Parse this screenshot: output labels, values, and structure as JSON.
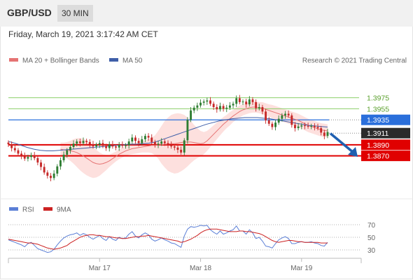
{
  "header": {
    "pair": "GBP/USD",
    "timeframe": "30 MIN"
  },
  "datetime": "Friday, March 19, 2021 3:17:42 AM CET",
  "legend": {
    "ma20": "MA 20 + Bollinger Bands",
    "ma50": "MA 50",
    "copyright": "Research © 2021 Trading Central"
  },
  "rsi_legend": {
    "rsi": "RSI",
    "ma9": "9MA"
  },
  "colors": {
    "up": "#2e7d32",
    "down": "#c62828",
    "ma20": "#e57373",
    "ma50": "#3f5fa8",
    "band": "#fde0de",
    "resistance": "#8ccf6a",
    "support": "#e00000",
    "pivot": "#2a6fdb",
    "arrow": "#1f5fb0",
    "rsi": "#5b7fd6",
    "rsi_ma": "#cc2222"
  },
  "chart_data": {
    "type": "candlestick",
    "ylim": [
      1.3795,
      1.4025
    ],
    "levels": [
      {
        "value": 1.3975,
        "label": "1.3975",
        "kind": "resistance"
      },
      {
        "value": 1.3955,
        "label": "1.3955",
        "kind": "resistance"
      },
      {
        "value": 1.3935,
        "label": "1.3935",
        "kind": "pivot"
      },
      {
        "value": 1.3911,
        "label": "1.3911",
        "kind": "last"
      },
      {
        "value": 1.389,
        "label": "1.3890",
        "kind": "support"
      },
      {
        "value": 1.387,
        "label": "1.3870",
        "kind": "support"
      }
    ],
    "x_tick_labels": [
      "Mar 17",
      "Mar 18",
      "Mar 19"
    ],
    "x_ticks_at": [
      28,
      59,
      90
    ],
    "closes": [
      1.3891,
      1.3884,
      1.388,
      1.3874,
      1.387,
      1.3865,
      1.3868,
      1.3871,
      1.3866,
      1.3858,
      1.385,
      1.384,
      1.3834,
      1.383,
      1.3838,
      1.3851,
      1.3862,
      1.3872,
      1.388,
      1.3886,
      1.3892,
      1.3896,
      1.3893,
      1.3897,
      1.3895,
      1.3891,
      1.3887,
      1.389,
      1.3893,
      1.3888,
      1.3884,
      1.3891,
      1.3887,
      1.3885,
      1.389,
      1.3888,
      1.3889,
      1.3896,
      1.3903,
      1.3897,
      1.3893,
      1.39,
      1.3906,
      1.3903,
      1.3895,
      1.389,
      1.3892,
      1.3896,
      1.3893,
      1.389,
      1.3887,
      1.3885,
      1.3881,
      1.3876,
      1.3898,
      1.3935,
      1.3952,
      1.3957,
      1.3961,
      1.3966,
      1.3968,
      1.397,
      1.3964,
      1.3958,
      1.3954,
      1.396,
      1.3955,
      1.3957,
      1.3961,
      1.3964,
      1.3974,
      1.3967,
      1.3968,
      1.3963,
      1.3972,
      1.3967,
      1.3956,
      1.3958,
      1.395,
      1.3934,
      1.3928,
      1.3922,
      1.393,
      1.3937,
      1.3943,
      1.3946,
      1.3943,
      1.3926,
      1.392,
      1.3923,
      1.3925,
      1.3924,
      1.3923,
      1.3924,
      1.3922,
      1.392,
      1.3912,
      1.3906,
      1.3913
    ],
    "ma20": [
      1.3882,
      1.3881,
      1.388,
      1.3879,
      1.3878,
      1.3876,
      1.3873,
      1.387,
      1.3866,
      1.3862,
      1.3858,
      1.3856,
      1.3855,
      1.3856,
      1.3858,
      1.3861,
      1.3865,
      1.3869,
      1.3873,
      1.3876,
      1.3879,
      1.3881,
      1.3883,
      1.3884,
      1.3885,
      1.3886,
      1.3887,
      1.3888,
      1.3889,
      1.3889,
      1.389,
      1.389,
      1.3891,
      1.3891,
      1.3892,
      1.3892,
      1.3893,
      1.3894,
      1.3895,
      1.3895,
      1.3895,
      1.3894,
      1.3893,
      1.3892,
      1.3893,
      1.3897,
      1.3903,
      1.3909,
      1.3915,
      1.3921,
      1.3927,
      1.3932,
      1.3937,
      1.3942,
      1.3946,
      1.395,
      1.3953,
      1.3955,
      1.3957,
      1.3958,
      1.3958,
      1.3957,
      1.3956,
      1.3954,
      1.3952,
      1.395,
      1.3948,
      1.3946,
      1.3944,
      1.3942,
      1.394,
      1.3938,
      1.3936,
      1.3934,
      1.3931,
      1.3928,
      1.3925,
      1.3923,
      1.3921,
      1.3919,
      1.3917,
      1.3916,
      1.3915
    ],
    "ma20_start": 16,
    "bb_halfwidth": [
      0.0012,
      0.0013,
      0.0015,
      0.0018,
      0.0022,
      0.0026,
      0.0029,
      0.0031,
      0.0031,
      0.003,
      0.0028,
      0.0025,
      0.0021,
      0.0017,
      0.0014,
      0.0011,
      0.001,
      0.0009,
      0.0009,
      0.0009,
      0.0009,
      0.0009,
      0.001,
      0.001,
      0.001,
      0.001,
      0.0011,
      0.0012,
      0.0014,
      0.0018,
      0.0025,
      0.0034,
      0.0042,
      0.0048,
      0.0052,
      0.0054,
      0.0054,
      0.0052,
      0.0049,
      0.0044,
      0.0038,
      0.0032,
      0.0027,
      0.0023,
      0.002,
      0.0018,
      0.0017,
      0.0016,
      0.0015,
      0.0014,
      0.0013,
      0.0012,
      0.0012,
      0.0011,
      0.0011,
      0.0011,
      0.001,
      0.001,
      0.001,
      0.001,
      0.001,
      0.001,
      0.0011,
      0.0011,
      0.0011,
      0.0012,
      0.0012
    ],
    "ma50": [
      1.3896,
      1.3893,
      1.3889,
      1.3885,
      1.3882,
      1.388,
      1.3879,
      1.3879,
      1.388,
      1.3881,
      1.3882,
      1.3883,
      1.3884,
      1.3885,
      1.3886,
      1.3887,
      1.3888,
      1.3889,
      1.389,
      1.3891,
      1.3891,
      1.3892,
      1.3893,
      1.3895,
      1.3899,
      1.3903,
      1.3907,
      1.3911,
      1.3915,
      1.3919,
      1.3923,
      1.3927,
      1.393,
      1.3933,
      1.3935,
      1.3937,
      1.3938,
      1.3939,
      1.3939,
      1.3939,
      1.3938,
      1.3937,
      1.3935,
      1.3933,
      1.3931,
      1.3929,
      1.3927,
      1.3925,
      1.3924,
      1.3923,
      1.3922
    ],
    "ma50_start": 0,
    "rsi": {
      "ylim": [
        20,
        80
      ],
      "ticks": [
        70,
        50,
        30
      ],
      "values": [
        46,
        44,
        42,
        40,
        38,
        35,
        40,
        42,
        37,
        32,
        30,
        28,
        26,
        27,
        31,
        38,
        44,
        49,
        52,
        54,
        55,
        57,
        53,
        56,
        54,
        50,
        47,
        50,
        53,
        48,
        45,
        51,
        47,
        45,
        50,
        48,
        49,
        55,
        59,
        52,
        49,
        54,
        57,
        54,
        47,
        44,
        46,
        49,
        46,
        44,
        41,
        40,
        37,
        34,
        52,
        63,
        67,
        66,
        67,
        69,
        68,
        69,
        62,
        58,
        55,
        60,
        55,
        57,
        60,
        62,
        68,
        60,
        60,
        55,
        62,
        57,
        48,
        50,
        44,
        36,
        35,
        33,
        40,
        46,
        49,
        51,
        48,
        40,
        40,
        42,
        43,
        42,
        42,
        43,
        41,
        40,
        37,
        36,
        42
      ],
      "ma9": [
        47,
        46,
        45,
        44,
        43,
        42,
        41,
        41,
        40,
        39,
        37,
        35,
        33,
        32,
        31,
        32,
        33,
        35,
        37,
        41,
        44,
        47,
        50,
        52,
        53,
        54,
        54,
        53,
        53,
        52,
        51,
        51,
        50,
        49,
        49,
        48,
        48,
        49,
        50,
        51,
        51,
        52,
        52,
        53,
        52,
        51,
        50,
        49,
        48,
        47,
        46,
        45,
        44,
        42,
        43,
        45,
        47,
        50,
        53,
        57,
        60,
        62,
        63,
        63,
        63,
        62,
        61,
        60,
        59,
        59,
        59,
        60,
        60,
        59,
        59,
        58,
        57,
        56,
        54,
        51,
        48,
        45,
        43,
        42,
        43,
        44,
        45,
        45,
        44,
        43,
        43,
        42,
        42,
        42,
        42,
        42,
        41,
        41,
        41
      ]
    },
    "rsi_labels": [
      "70",
      "50",
      "30"
    ]
  }
}
